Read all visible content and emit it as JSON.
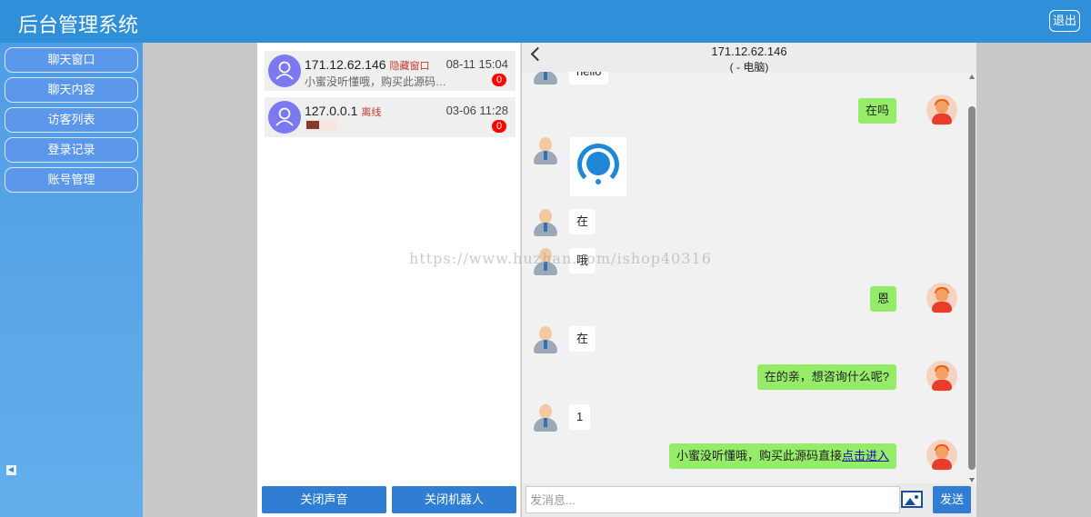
{
  "header": {
    "title": "后台管理系统",
    "logout_label": "退出"
  },
  "sidebar": {
    "items": [
      {
        "label": "聊天窗口"
      },
      {
        "label": "聊天内容"
      },
      {
        "label": "访客列表"
      },
      {
        "label": "登录记录"
      },
      {
        "label": "账号管理"
      }
    ]
  },
  "sessions": [
    {
      "ip": "171.12.62.146",
      "tag": "隐藏窗口",
      "time": "08-11 15:04",
      "preview": "小蜜没听懂哦，购买此源码直...",
      "unread": "0"
    },
    {
      "ip": "127.0.0.1",
      "tag": "离线",
      "time": "03-06 11:28",
      "preview": "",
      "unread": "0"
    }
  ],
  "session_buttons": {
    "mute_label": "关闭声音",
    "robot_label": "关闭机器人"
  },
  "chat": {
    "ip": "171.12.62.146",
    "device": "( - 电脑)",
    "messages": [
      {
        "side": "left",
        "text": "hello"
      },
      {
        "side": "right",
        "text": "在吗"
      },
      {
        "side": "left",
        "text": ""
      },
      {
        "side": "left",
        "text": "在"
      },
      {
        "side": "left",
        "text": "哦"
      },
      {
        "side": "right",
        "text": "恩"
      },
      {
        "side": "left",
        "text": "在"
      },
      {
        "side": "right",
        "text": "在的亲，想咨询什么呢?"
      },
      {
        "side": "left",
        "text": "1"
      },
      {
        "side": "right",
        "text": "小蜜没听懂哦，购买此源码直接",
        "link": "点击进入"
      }
    ],
    "input_placeholder": "发消息...",
    "send_label": "发送"
  },
  "watermark": "https://www.huzhan.com/ishop40316",
  "colors": {
    "header": "#2f8fd8",
    "sidebar": "#5b97ea",
    "accent": "#2f7ed3",
    "bubble_right": "#95ec69",
    "badge": "#ff0000"
  }
}
